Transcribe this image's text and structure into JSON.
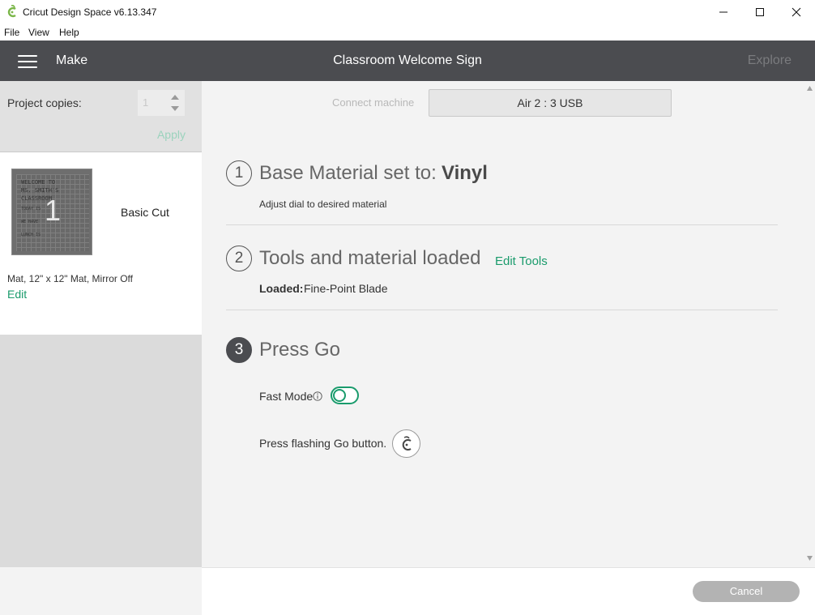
{
  "window": {
    "title": "Cricut Design Space  v6.13.347",
    "app_icon": "cricut-logo-icon",
    "controls": [
      "minimize-icon",
      "maximize-icon",
      "close-icon"
    ]
  },
  "menu": {
    "items": [
      "File",
      "View",
      "Help"
    ]
  },
  "header": {
    "menu_icon": "hamburger-icon",
    "section": "Make",
    "project_title": "Classroom Welcome Sign",
    "explore": "Explore"
  },
  "sidebar": {
    "copies_label": "Project copies:",
    "copies_value": "1",
    "apply_label": "Apply",
    "mat": {
      "number": "1",
      "type": "Basic Cut",
      "description": "Mat, 12\" x 12\" Mat, Mirror Off",
      "edit_label": "Edit",
      "thumb_lines": [
        "WELCOME TO",
        "MS. SMITH'S",
        "CLASSROOM",
        "TODAY IS",
        "WE HAVE",
        "LUNCH IS"
      ]
    }
  },
  "machine": {
    "connect_label": "Connect machine",
    "selected": "Air 2 : 3 USB"
  },
  "steps": {
    "step1": {
      "number": "1",
      "title": "Base Material set to:",
      "material": "Vinyl",
      "hint": "Adjust dial to desired material"
    },
    "step2": {
      "number": "2",
      "title": "Tools and material loaded",
      "edit_tools": "Edit Tools",
      "loaded_label": "Loaded:",
      "loaded_value": "Fine-Point Blade"
    },
    "step3": {
      "number": "3",
      "title": "Press Go",
      "fast_mode_label": "Fast Mode",
      "fast_mode_on": false,
      "press_label": "Press flashing Go button."
    }
  },
  "footer": {
    "cancel_label": "Cancel"
  },
  "colors": {
    "header_bg": "#4b4c50",
    "accent_green": "#1a9b6c",
    "apply_disabled": "#9bd3bd",
    "cancel_bg": "#b3b3b3"
  }
}
